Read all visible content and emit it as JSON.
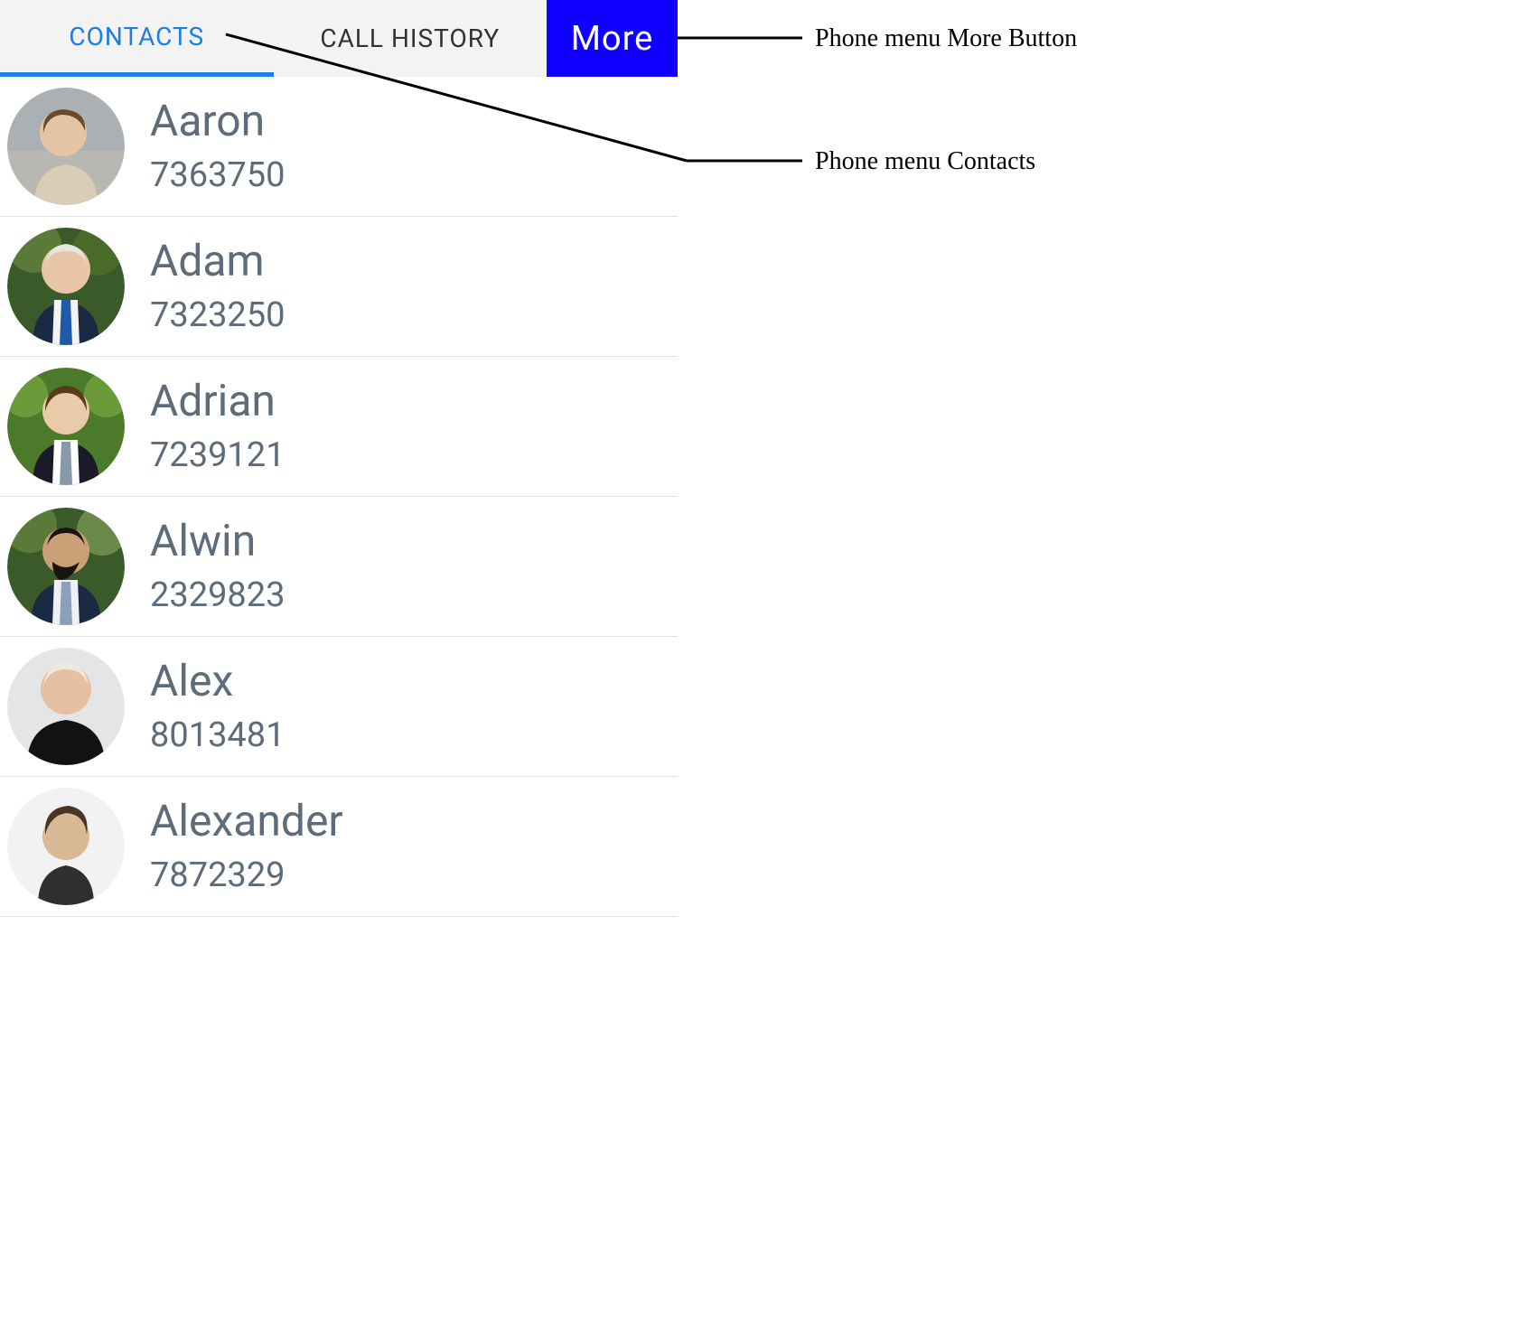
{
  "tabs": {
    "contacts": "CONTACTS",
    "call_history": "CALL HISTORY",
    "more": "More"
  },
  "contacts": [
    {
      "name": "Aaron",
      "number": "7363750"
    },
    {
      "name": "Adam",
      "number": "7323250"
    },
    {
      "name": "Adrian",
      "number": "7239121"
    },
    {
      "name": "Alwin",
      "number": "2329823"
    },
    {
      "name": "Alex",
      "number": "8013481"
    },
    {
      "name": "Alexander",
      "number": "7872329"
    }
  ],
  "annotations": {
    "more_button": "Phone menu More Button",
    "contacts": "Phone menu Contacts"
  }
}
